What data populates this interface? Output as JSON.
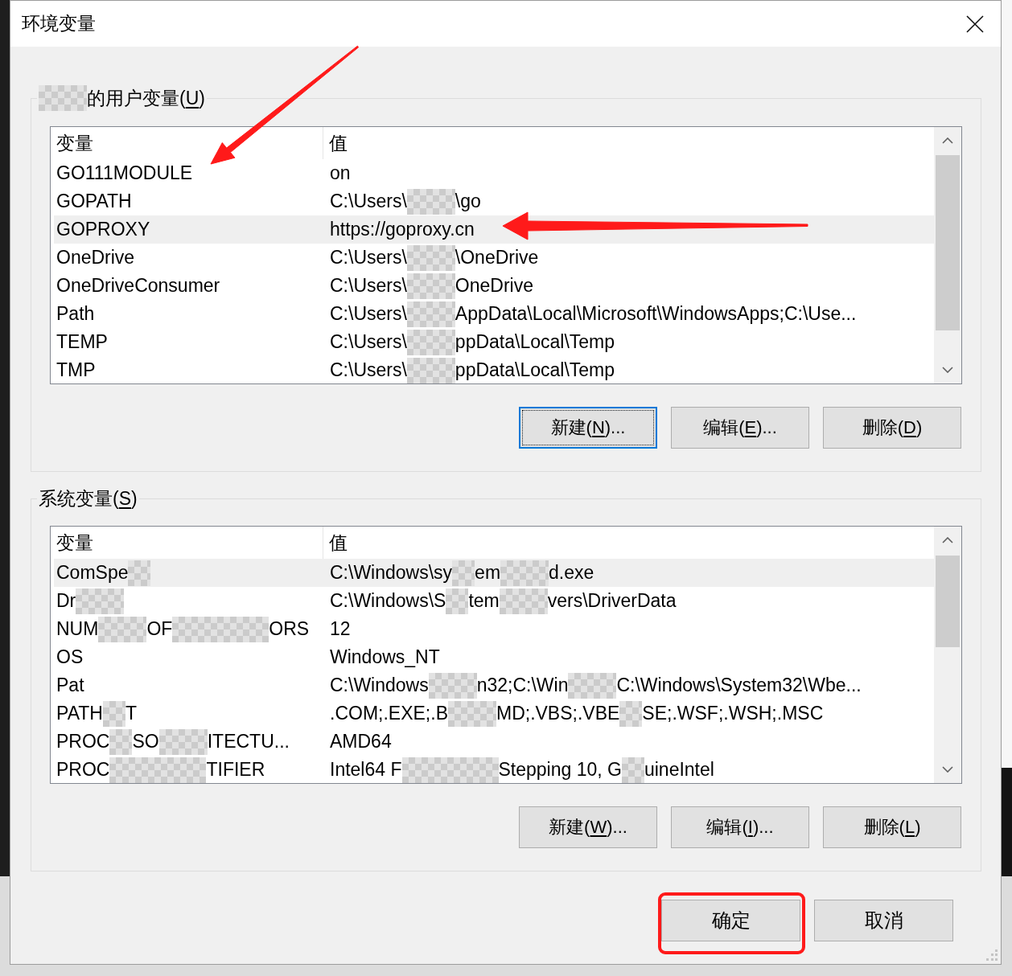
{
  "window": {
    "title": "环境变量"
  },
  "user_variables": {
    "heading": [
      {
        "kind": "redacted"
      },
      {
        "kind": "text",
        "text": "的用户变量("
      },
      {
        "kind": "mnemonic",
        "text": "U"
      },
      {
        "kind": "text",
        "text": ")"
      }
    ],
    "columns": [
      "变量",
      "值"
    ],
    "rows": [
      {
        "name": "GO111MODULE",
        "value": "on",
        "selected": false
      },
      {
        "name": "GOPATH",
        "value": [
          {
            "kind": "text",
            "text": "C:\\Users\\"
          },
          {
            "kind": "redacted"
          },
          {
            "kind": "text",
            "text": "\\go"
          }
        ],
        "selected": false
      },
      {
        "name": "GOPROXY",
        "value": "https://goproxy.cn",
        "selected": true
      },
      {
        "name": "OneDrive",
        "value": [
          {
            "kind": "text",
            "text": "C:\\Users\\"
          },
          {
            "kind": "redacted"
          },
          {
            "kind": "text",
            "text": "\\OneDrive"
          }
        ],
        "selected": false
      },
      {
        "name": "OneDriveConsumer",
        "value": [
          {
            "kind": "text",
            "text": "C:\\Users\\"
          },
          {
            "kind": "redacted"
          },
          {
            "kind": "text",
            "text": "OneDrive"
          }
        ],
        "selected": false
      },
      {
        "name": "Path",
        "value": [
          {
            "kind": "text",
            "text": "C:\\Users\\"
          },
          {
            "kind": "redacted"
          },
          {
            "kind": "text",
            "text": "AppData\\Local\\Microsoft\\WindowsApps;C:\\Use..."
          }
        ],
        "selected": false
      },
      {
        "name": "TEMP",
        "value": [
          {
            "kind": "text",
            "text": "C:\\Users\\"
          },
          {
            "kind": "redacted"
          },
          {
            "kind": "text",
            "text": "ppData\\Local\\Temp"
          }
        ],
        "selected": false
      },
      {
        "name": "TMP",
        "value": [
          {
            "kind": "text",
            "text": "C:\\Users\\"
          },
          {
            "kind": "redacted"
          },
          {
            "kind": "text",
            "text": "ppData\\Local\\Temp"
          }
        ],
        "selected": false
      }
    ],
    "buttons": [
      {
        "label": [
          {
            "kind": "text",
            "text": "新建("
          },
          {
            "kind": "mnemonic",
            "text": "N"
          },
          {
            "kind": "text",
            "text": ")..."
          }
        ],
        "focused": true
      },
      {
        "label": [
          {
            "kind": "text",
            "text": "编辑("
          },
          {
            "kind": "mnemonic",
            "text": "E"
          },
          {
            "kind": "text",
            "text": ")..."
          }
        ],
        "focused": false
      },
      {
        "label": [
          {
            "kind": "text",
            "text": "删除("
          },
          {
            "kind": "mnemonic",
            "text": "D"
          },
          {
            "kind": "text",
            "text": ")"
          }
        ],
        "focused": false
      }
    ]
  },
  "system_variables": {
    "heading": [
      {
        "kind": "text",
        "text": "系统变量("
      },
      {
        "kind": "mnemonic",
        "text": "S"
      },
      {
        "kind": "text",
        "text": ")"
      }
    ],
    "columns": [
      "变量",
      "值"
    ],
    "rows": [
      {
        "name": [
          {
            "kind": "text",
            "text": "ComSpe"
          },
          {
            "kind": "redacted_narrow"
          }
        ],
        "value": [
          {
            "kind": "text",
            "text": "C:\\Windows\\sy"
          },
          {
            "kind": "redacted_narrow"
          },
          {
            "kind": "text",
            "text": "em"
          },
          {
            "kind": "redacted"
          },
          {
            "kind": "text",
            "text": "d.exe"
          }
        ],
        "selected": true
      },
      {
        "name": [
          {
            "kind": "text",
            "text": "Dr"
          },
          {
            "kind": "redacted"
          }
        ],
        "value": [
          {
            "kind": "text",
            "text": "C:\\Windows\\S"
          },
          {
            "kind": "redacted_narrow"
          },
          {
            "kind": "text",
            "text": "tem"
          },
          {
            "kind": "redacted"
          },
          {
            "kind": "text",
            "text": "vers\\DriverData"
          }
        ],
        "selected": false
      },
      {
        "name": [
          {
            "kind": "text",
            "text": "NUM"
          },
          {
            "kind": "redacted"
          },
          {
            "kind": "text",
            "text": "OF"
          },
          {
            "kind": "redacted_wide"
          },
          {
            "kind": "text",
            "text": "ORS"
          }
        ],
        "value": "12",
        "selected": false
      },
      {
        "name": "OS",
        "value": "Windows_NT",
        "selected": false
      },
      {
        "name": "Pat",
        "value": [
          {
            "kind": "text",
            "text": "C:\\Windows"
          },
          {
            "kind": "redacted"
          },
          {
            "kind": "text",
            "text": "n32;C:\\Win"
          },
          {
            "kind": "redacted"
          },
          {
            "kind": "text",
            "text": "C:\\Windows\\System32\\Wbe..."
          }
        ],
        "selected": false
      },
      {
        "name": [
          {
            "kind": "text",
            "text": "PATH"
          },
          {
            "kind": "redacted_narrow"
          },
          {
            "kind": "text",
            "text": "T"
          }
        ],
        "value": [
          {
            "kind": "text",
            "text": ".COM;.EXE;.B"
          },
          {
            "kind": "redacted"
          },
          {
            "kind": "text",
            "text": "MD;.VBS;.VBE"
          },
          {
            "kind": "redacted_narrow"
          },
          {
            "kind": "text",
            "text": "SE;.WSF;.WSH;.MSC"
          }
        ],
        "selected": false
      },
      {
        "name": [
          {
            "kind": "text",
            "text": "PROC"
          },
          {
            "kind": "redacted_narrow"
          },
          {
            "kind": "text",
            "text": "SO"
          },
          {
            "kind": "redacted"
          },
          {
            "kind": "text",
            "text": "ITECTU..."
          }
        ],
        "value": "AMD64",
        "selected": false
      },
      {
        "name": [
          {
            "kind": "text",
            "text": "PROC"
          },
          {
            "kind": "redacted_wide"
          },
          {
            "kind": "text",
            "text": "TIFIER"
          }
        ],
        "value": [
          {
            "kind": "text",
            "text": "Intel64 F"
          },
          {
            "kind": "redacted_wide"
          },
          {
            "kind": "text",
            "text": "Stepping 10, G"
          },
          {
            "kind": "redacted_narrow"
          },
          {
            "kind": "text",
            "text": "uineIntel"
          }
        ],
        "selected": false
      }
    ],
    "buttons": [
      {
        "label": [
          {
            "kind": "text",
            "text": "新建("
          },
          {
            "kind": "mnemonic",
            "text": "W"
          },
          {
            "kind": "text",
            "text": ")..."
          }
        ],
        "focused": false
      },
      {
        "label": [
          {
            "kind": "text",
            "text": "编辑("
          },
          {
            "kind": "mnemonic",
            "text": "I"
          },
          {
            "kind": "text",
            "text": ")..."
          }
        ],
        "focused": false
      },
      {
        "label": [
          {
            "kind": "text",
            "text": "删除("
          },
          {
            "kind": "mnemonic",
            "text": "L"
          },
          {
            "kind": "text",
            "text": ")"
          }
        ],
        "focused": false
      }
    ]
  },
  "dialog_buttons": [
    {
      "label": "确定",
      "focused": false
    },
    {
      "label": "取消",
      "focused": false
    }
  ]
}
